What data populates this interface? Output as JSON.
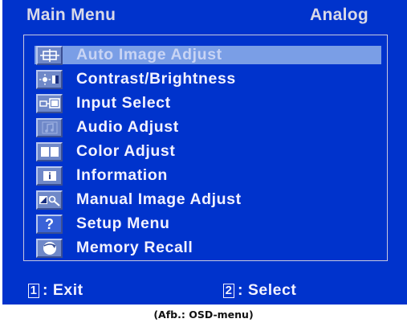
{
  "header": {
    "title": "Main Menu",
    "source": "Analog"
  },
  "menu": {
    "items": [
      {
        "label": "Auto Image Adjust",
        "icon": "auto-adjust-icon",
        "selected": true
      },
      {
        "label": "Contrast/Brightness",
        "icon": "contrast-brightness-icon"
      },
      {
        "label": "Input Select",
        "icon": "input-select-icon"
      },
      {
        "label": "Audio Adjust",
        "icon": "audio-icon"
      },
      {
        "label": "Color Adjust",
        "icon": "color-adjust-icon"
      },
      {
        "label": "Information",
        "icon": "info-icon"
      },
      {
        "label": "Manual Image Adjust",
        "icon": "manual-adjust-icon"
      },
      {
        "label": "Setup Menu",
        "icon": "setup-icon"
      },
      {
        "label": "Memory Recall",
        "icon": "memory-recall-icon"
      }
    ]
  },
  "footer": {
    "exit_key": "1",
    "exit_label": ": Exit",
    "select_key": "2",
    "select_label": ": Select"
  },
  "caption": "(Afb.: OSD-menu)",
  "colors": {
    "background": "#0033cc",
    "highlight": "#7a9ee6",
    "text": "#f2f2ff"
  }
}
